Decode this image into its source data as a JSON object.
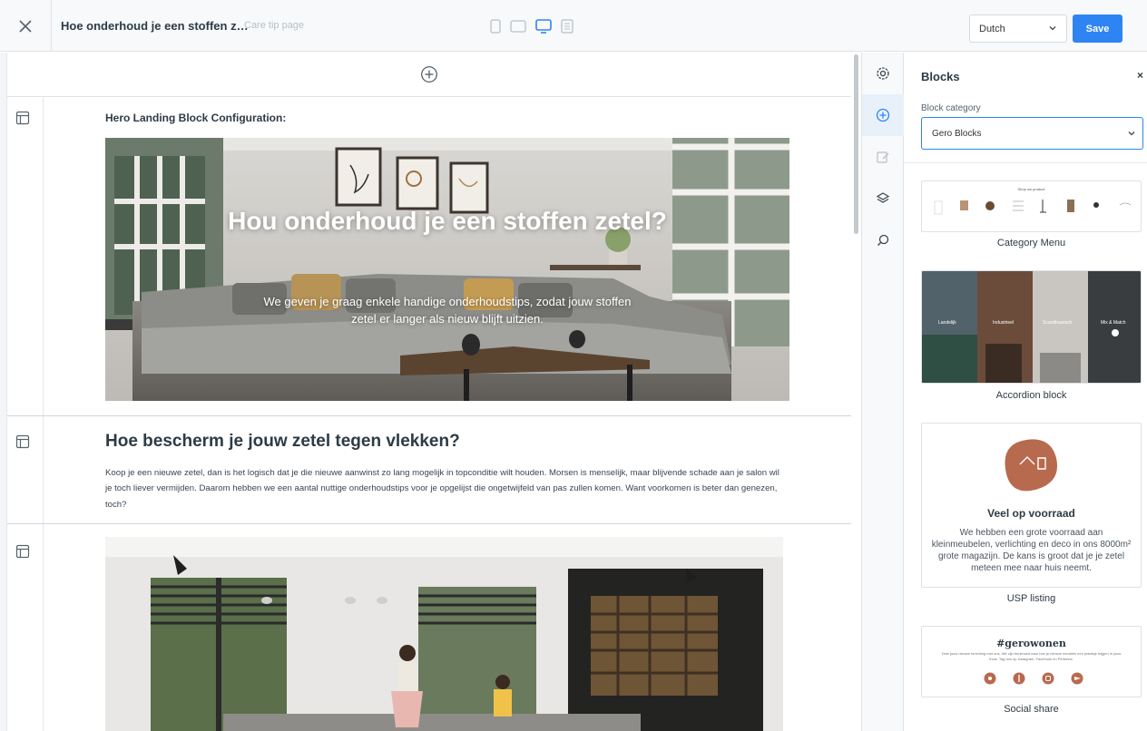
{
  "header": {
    "page_title": "Hoe onderhoud je een stoffen z…",
    "page_type": "Care tip page",
    "language": "Dutch",
    "save_label": "Save",
    "devices": [
      "mobile",
      "tablet",
      "desktop",
      "list"
    ],
    "active_device": "desktop"
  },
  "canvas": {
    "hero": {
      "config_label": "Hero Landing Block Configuration:",
      "title": "Hou onderhoud je een stoffen zetel?",
      "subtitle": "We geven je graag enkele handige onderhoudstips, zodat jouw stoffen zetel er langer als nieuw blijft uitzien."
    },
    "text_block": {
      "heading": "Hoe bescherm je jouw zetel tegen vlekken?",
      "body": "Koop je een nieuwe zetel, dan is het logisch dat je die nieuwe aanwinst zo lang mogelijk in topconditie wilt houden. Morsen is menselijk, maar blijvende schade aan je salon wil je toch liever vermijden. Daarom hebben we een aantal nuttige onderhoudstips voor je opgelijst die ongetwijfeld van pas zullen komen. Want voorkomen is beter dan genezen, toch?"
    }
  },
  "rail": {
    "items": [
      "settings-icon",
      "add-block-icon",
      "edit-icon",
      "layers-icon",
      "search-icon"
    ],
    "active": "add-block-icon"
  },
  "panel": {
    "title": "Blocks",
    "close": "×",
    "category_label": "Block category",
    "category_value": "Gero Blocks",
    "blocks": [
      {
        "label": "Category Menu",
        "preview_title": "Shop uw product"
      },
      {
        "label": "Accordion block",
        "preview_labels": [
          "Landelijk",
          "Industrieel",
          "Scandinavisch",
          "Mix & Match"
        ]
      },
      {
        "label": "USP listing",
        "preview_title": "Veel op voorraad",
        "preview_text": "We hebben een grote voorraad aan kleinmeubelen, verlichting en deco in ons 8000m² grote magazijn. De kans is groot dat je je zetel meteen mee naar huis neemt."
      },
      {
        "label": "Social share",
        "preview_title": "#gerowonen",
        "preview_text": "Deel jouw nieuwe inrichting met ons. We zijn benieuwd naar hoe je nieuwe meubels een plaatsje krijgen in jouw thuis. Tag ons op Instagram, Facebook en Pinterest."
      }
    ]
  },
  "colors": {
    "accent": "#2f84f3",
    "brand_terracotta": "#b86a4f",
    "text_dark": "#2d3b45"
  }
}
